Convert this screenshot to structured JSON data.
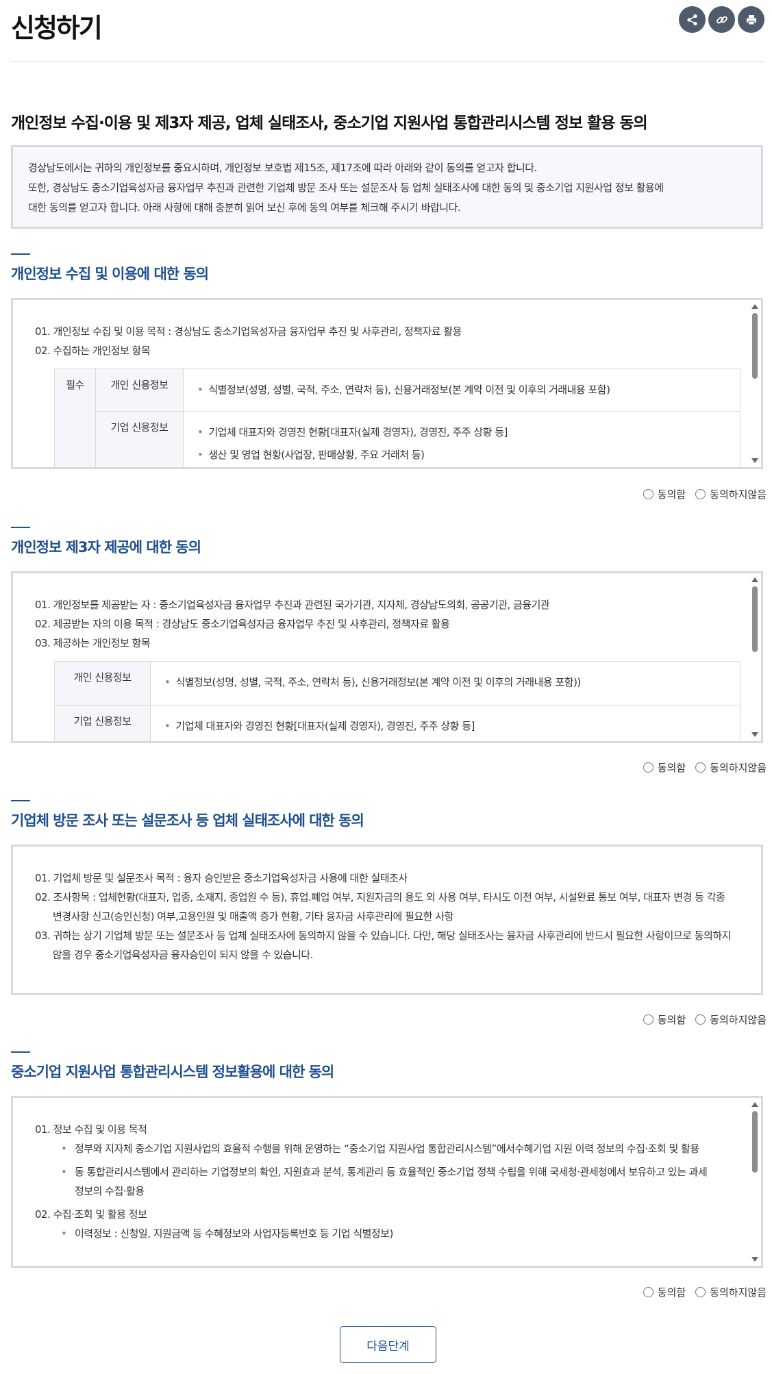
{
  "page": {
    "title": "신청하기",
    "actions": {
      "share": "share-icon",
      "link": "link-icon",
      "print": "print-icon"
    }
  },
  "main_heading": "개인정보 수집·이용 및 제3자 제공, 업체 실태조사, 중소기업 지원사업 통합관리시스템 정보 활용 동의",
  "intro": [
    "경상남도에서는 귀하의 개인정보를 중요시하며, 개인정보 보호법 제15조, 제17조에 따라 아래와 같이 동의를 얻고자 합니다.",
    "또한, 경상남도 중소기업육성자금 융자업무 추진과 관련한 기업체 방문 조사 또는 설문조사 등 업체 실태조사에 대한 동의 및 중소기업 지원사업 정보 활용에",
    "대한 동의를 얻고자 합니다. 아래 사항에 대해 충분히 읽어 보신 후에 동의 여부를 체크해 주시기 바랍니다."
  ],
  "radio": {
    "agree": "동의함",
    "disagree": "동의하지않음"
  },
  "sections": [
    {
      "title": "개인정보 수집 및 이용에 대한 동의",
      "lines": [
        "01. 개인정보 수집 및 이용 목적 : 경상남도 중소기업육성자금 융자업무 추진 및 사후관리, 정책자료 활용",
        "02. 수집하는 개인정보 항목"
      ],
      "table": {
        "required_label": "필수",
        "rows": [
          {
            "category": "개인 신용정보",
            "bullets": [
              "식별정보(성명, 성별, 국적, 주소, 연락처 등), 신용거래정보(본 계약 이전 및 이후의 거래내용 포함)"
            ]
          },
          {
            "category": "기업 신용정보",
            "bullets": [
              "기업체 대표자와 경영진 현황[대표자(실제 경영자), 경영진, 주주 상황 등]",
              "생산 및 영업 현황(사업장, 판매상황, 주요 거래처 등)"
            ]
          }
        ]
      }
    },
    {
      "title": "개인정보 제3자 제공에 대한 동의",
      "lines": [
        "01. 개인정보를 제공받는 자 : 중소기업육성자금 융자업무 추진과 관련된 국가기관, 지자체, 경상남도의회, 공공기관, 금융기관",
        "02. 제공받는 자의 이용 목적 : 경상남도 중소기업육성자금 융자업무 추진 및 사후관리, 정책자료 활용",
        "03. 제공하는 개인정보 항목"
      ],
      "table": {
        "rows": [
          {
            "category": "개인 신용정보",
            "bullets": [
              "식별정보(성명, 성별, 국적, 주소, 연락처 등), 신용거래정보(본 계약 이전 및 이후의 거래내용 포함))"
            ]
          },
          {
            "category": "기업 신용정보",
            "bullets": [
              "기업체 대표자와 경영진 현황[대표자(실제 경영자), 경영진, 주주 상황 등]"
            ]
          }
        ]
      }
    },
    {
      "title": "기업체 방문 조사 또는 설문조사 등 업체 실태조사에 대한 동의",
      "lines": [
        "01. 기업체 방문 및 설문조사 목적 : 융자 승인받은 중소기업육성자금 사용에 대한 실태조사",
        "02. 조사항목 : 업체현황(대표자, 업종, 소재지, 종업원 수 등), 휴업.폐업 여부, 지원자금의 용도 외 사용 여부, 타시도 이전 여부, 시설완료 통보 여부, 대표자 변경 등 각종 변경사항 신고(승인신청) 여부,고용인원 및 매출액 증가 현황, 기타 융자금 사후관리에 필요한 사항",
        "03. 귀하는 상기 기업체 방문 또는 설문조사 등 업체 실태조사에 동의하지 않을 수 있습니다. 다만, 해당 실태조사는 융자금 사후관리에 반드시 필요한 사항이므로 동의하지 않을 경우 중소기업육성자금 융자승인이 되지 않을 수 있습니다."
      ]
    },
    {
      "title": "중소기업 지원사업 통합관리시스템 정보활용에 대한 동의",
      "heading1": "01. 정보 수집 및 이용 목적",
      "bullets": [
        "정부와 지자체 중소기업 지원사업의 효율적 수행을 위해 운영하는 “중소기업 지원사업 통합관리시스템”에서수혜기업 지원 이력 정보의 수집·조회 및 활용",
        "동 통합관리시스템에서 관리하는 기업정보의 확인, 지원효과 분석, 통계관리 등 효율적인 중소기업 정책 수립을 위해 국세청·관세청에서 보유하고 있는 과세정보의 수집·활용"
      ],
      "heading2": "02. 수집·조회 및 활용 정보",
      "bullets2": [
        "이력정보 : 신청일, 지원금액 등 수혜정보와 사업자등록번호 등 기업 식별정보)"
      ]
    }
  ],
  "next_button": "다음단계"
}
